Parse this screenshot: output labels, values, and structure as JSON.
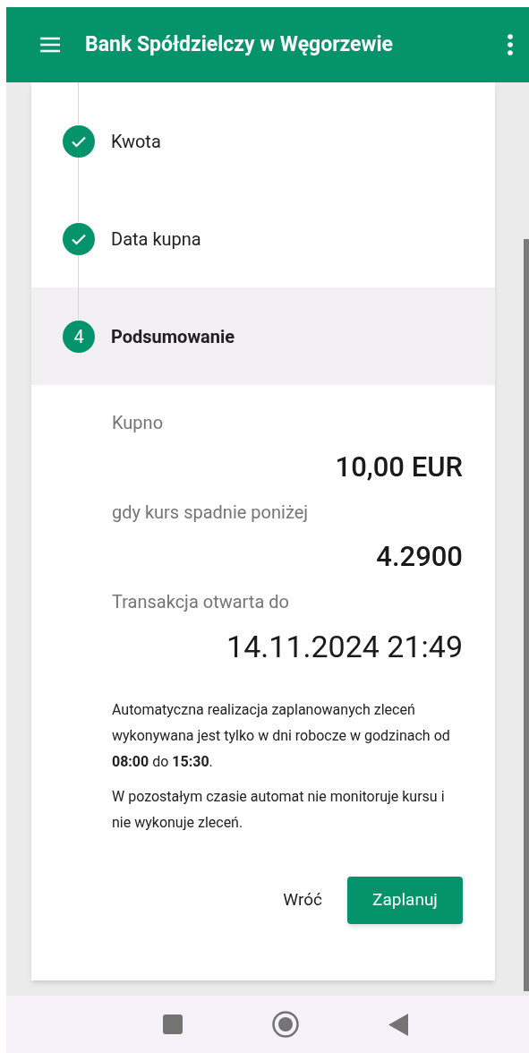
{
  "app_bar": {
    "title": "Bank Spółdzielczy w Węgorzewie"
  },
  "steps": [
    {
      "label": "Kwota",
      "kind": "done",
      "selected": false
    },
    {
      "label": "Data kupna",
      "kind": "done",
      "selected": false
    },
    {
      "label": "Podsumowanie",
      "kind": "current",
      "number": "4",
      "selected": true
    }
  ],
  "summary": [
    {
      "label": "Kupno",
      "value": "10,00 EUR"
    },
    {
      "label": "gdy kurs spadnie poniżej",
      "value": "4.2900"
    },
    {
      "label": "Transakcja otwarta do",
      "value": "14.11.2024 21:49"
    }
  ],
  "notes": [
    "Automatyczna realizacja zaplanowanych zleceń wykonywana jest tylko w dni robocze w godzinach od **08:00** do **15:30**.",
    "W pozostałym czasie automat nie monitoruje kursu i nie wykonuje zleceń."
  ],
  "buttons": {
    "back": "Wróć",
    "submit": "Zaplanuj"
  }
}
